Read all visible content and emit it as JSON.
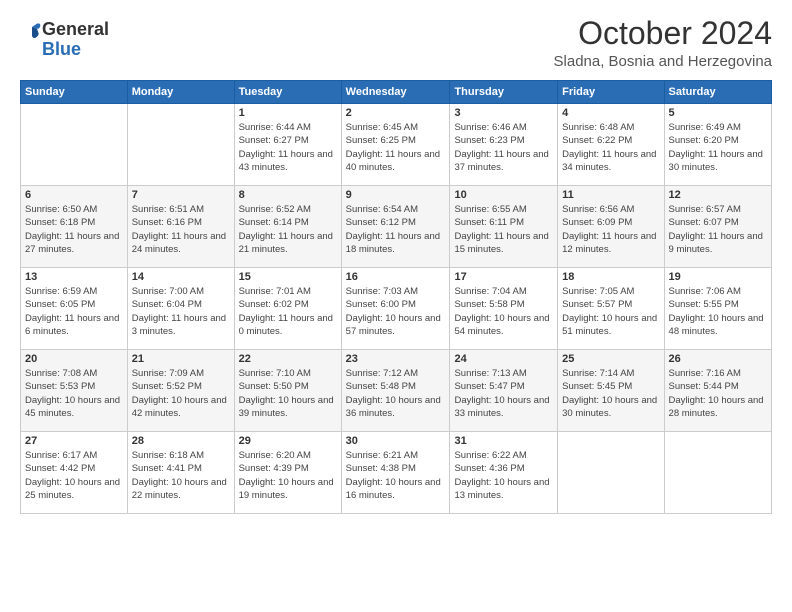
{
  "logo": {
    "general": "General",
    "blue": "Blue"
  },
  "header": {
    "month": "October 2024",
    "location": "Sladna, Bosnia and Herzegovina"
  },
  "weekdays": [
    "Sunday",
    "Monday",
    "Tuesday",
    "Wednesday",
    "Thursday",
    "Friday",
    "Saturday"
  ],
  "weeks": [
    [
      {
        "day": "",
        "info": ""
      },
      {
        "day": "",
        "info": ""
      },
      {
        "day": "1",
        "info": "Sunrise: 6:44 AM\nSunset: 6:27 PM\nDaylight: 11 hours and 43 minutes."
      },
      {
        "day": "2",
        "info": "Sunrise: 6:45 AM\nSunset: 6:25 PM\nDaylight: 11 hours and 40 minutes."
      },
      {
        "day": "3",
        "info": "Sunrise: 6:46 AM\nSunset: 6:23 PM\nDaylight: 11 hours and 37 minutes."
      },
      {
        "day": "4",
        "info": "Sunrise: 6:48 AM\nSunset: 6:22 PM\nDaylight: 11 hours and 34 minutes."
      },
      {
        "day": "5",
        "info": "Sunrise: 6:49 AM\nSunset: 6:20 PM\nDaylight: 11 hours and 30 minutes."
      }
    ],
    [
      {
        "day": "6",
        "info": "Sunrise: 6:50 AM\nSunset: 6:18 PM\nDaylight: 11 hours and 27 minutes."
      },
      {
        "day": "7",
        "info": "Sunrise: 6:51 AM\nSunset: 6:16 PM\nDaylight: 11 hours and 24 minutes."
      },
      {
        "day": "8",
        "info": "Sunrise: 6:52 AM\nSunset: 6:14 PM\nDaylight: 11 hours and 21 minutes."
      },
      {
        "day": "9",
        "info": "Sunrise: 6:54 AM\nSunset: 6:12 PM\nDaylight: 11 hours and 18 minutes."
      },
      {
        "day": "10",
        "info": "Sunrise: 6:55 AM\nSunset: 6:11 PM\nDaylight: 11 hours and 15 minutes."
      },
      {
        "day": "11",
        "info": "Sunrise: 6:56 AM\nSunset: 6:09 PM\nDaylight: 11 hours and 12 minutes."
      },
      {
        "day": "12",
        "info": "Sunrise: 6:57 AM\nSunset: 6:07 PM\nDaylight: 11 hours and 9 minutes."
      }
    ],
    [
      {
        "day": "13",
        "info": "Sunrise: 6:59 AM\nSunset: 6:05 PM\nDaylight: 11 hours and 6 minutes."
      },
      {
        "day": "14",
        "info": "Sunrise: 7:00 AM\nSunset: 6:04 PM\nDaylight: 11 hours and 3 minutes."
      },
      {
        "day": "15",
        "info": "Sunrise: 7:01 AM\nSunset: 6:02 PM\nDaylight: 11 hours and 0 minutes."
      },
      {
        "day": "16",
        "info": "Sunrise: 7:03 AM\nSunset: 6:00 PM\nDaylight: 10 hours and 57 minutes."
      },
      {
        "day": "17",
        "info": "Sunrise: 7:04 AM\nSunset: 5:58 PM\nDaylight: 10 hours and 54 minutes."
      },
      {
        "day": "18",
        "info": "Sunrise: 7:05 AM\nSunset: 5:57 PM\nDaylight: 10 hours and 51 minutes."
      },
      {
        "day": "19",
        "info": "Sunrise: 7:06 AM\nSunset: 5:55 PM\nDaylight: 10 hours and 48 minutes."
      }
    ],
    [
      {
        "day": "20",
        "info": "Sunrise: 7:08 AM\nSunset: 5:53 PM\nDaylight: 10 hours and 45 minutes."
      },
      {
        "day": "21",
        "info": "Sunrise: 7:09 AM\nSunset: 5:52 PM\nDaylight: 10 hours and 42 minutes."
      },
      {
        "day": "22",
        "info": "Sunrise: 7:10 AM\nSunset: 5:50 PM\nDaylight: 10 hours and 39 minutes."
      },
      {
        "day": "23",
        "info": "Sunrise: 7:12 AM\nSunset: 5:48 PM\nDaylight: 10 hours and 36 minutes."
      },
      {
        "day": "24",
        "info": "Sunrise: 7:13 AM\nSunset: 5:47 PM\nDaylight: 10 hours and 33 minutes."
      },
      {
        "day": "25",
        "info": "Sunrise: 7:14 AM\nSunset: 5:45 PM\nDaylight: 10 hours and 30 minutes."
      },
      {
        "day": "26",
        "info": "Sunrise: 7:16 AM\nSunset: 5:44 PM\nDaylight: 10 hours and 28 minutes."
      }
    ],
    [
      {
        "day": "27",
        "info": "Sunrise: 6:17 AM\nSunset: 4:42 PM\nDaylight: 10 hours and 25 minutes."
      },
      {
        "day": "28",
        "info": "Sunrise: 6:18 AM\nSunset: 4:41 PM\nDaylight: 10 hours and 22 minutes."
      },
      {
        "day": "29",
        "info": "Sunrise: 6:20 AM\nSunset: 4:39 PM\nDaylight: 10 hours and 19 minutes."
      },
      {
        "day": "30",
        "info": "Sunrise: 6:21 AM\nSunset: 4:38 PM\nDaylight: 10 hours and 16 minutes."
      },
      {
        "day": "31",
        "info": "Sunrise: 6:22 AM\nSunset: 4:36 PM\nDaylight: 10 hours and 13 minutes."
      },
      {
        "day": "",
        "info": ""
      },
      {
        "day": "",
        "info": ""
      }
    ]
  ]
}
